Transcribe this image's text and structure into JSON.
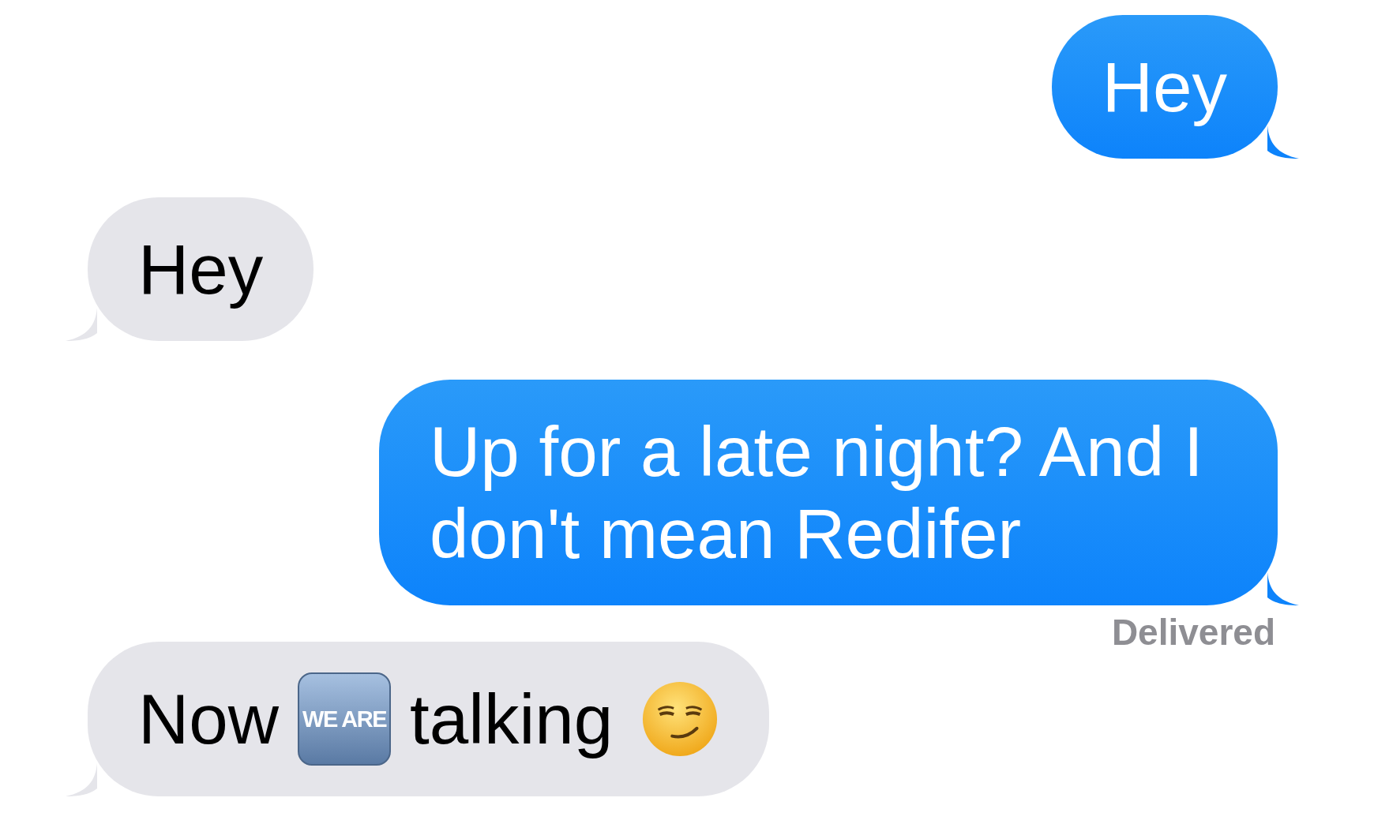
{
  "messages": [
    {
      "kind": "sent",
      "parts": [
        {
          "kind": "text",
          "text": "Hey"
        }
      ]
    },
    {
      "kind": "received",
      "parts": [
        {
          "kind": "text",
          "text": "Hey"
        }
      ]
    },
    {
      "kind": "sent",
      "parts": [
        {
          "kind": "text",
          "text": "Up for a late night? And I don't mean Redifer"
        }
      ]
    },
    {
      "kind": "status",
      "text": "Delivered"
    },
    {
      "kind": "received",
      "parts": [
        {
          "kind": "text",
          "text": "Now"
        },
        {
          "kind": "sticker",
          "text": "WE ARE"
        },
        {
          "kind": "text",
          "text": "talking"
        },
        {
          "kind": "emoji"
        }
      ]
    }
  ]
}
